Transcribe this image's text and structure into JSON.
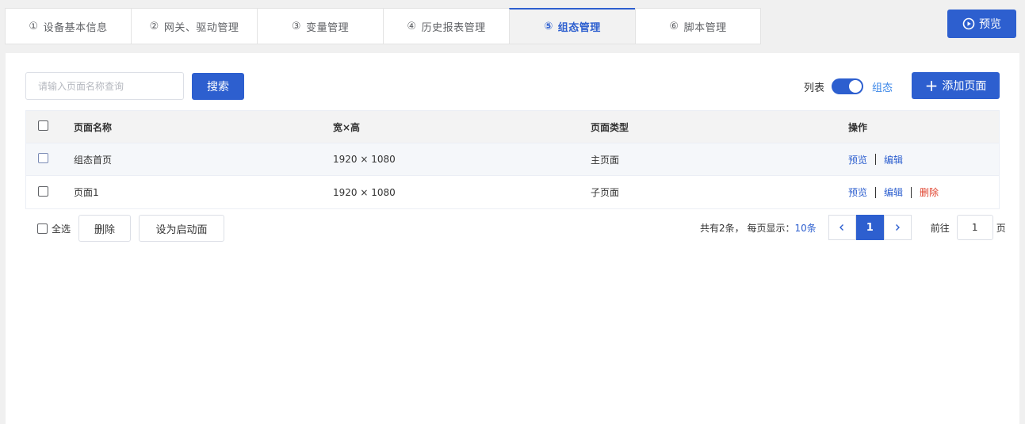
{
  "tabs": [
    {
      "num": "①",
      "label": "设备基本信息"
    },
    {
      "num": "②",
      "label": "网关、驱动管理"
    },
    {
      "num": "③",
      "label": "变量管理"
    },
    {
      "num": "④",
      "label": "历史报表管理"
    },
    {
      "num": "⑤",
      "label": "组态管理"
    },
    {
      "num": "⑥",
      "label": "脚本管理"
    }
  ],
  "active_tab": 4,
  "header": {
    "preview_label": "预览",
    "preview_icon": "play-circle-icon"
  },
  "toolbar": {
    "search_placeholder": "请输入页面名称查询",
    "search_value": "",
    "search_label": "搜索",
    "toggle_left_label": "列表",
    "toggle_right_label": "组态",
    "toggle_state": "组态",
    "add_label": "添加页面",
    "add_icon": "plus-icon"
  },
  "table": {
    "columns": [
      "页面名称",
      "宽×高",
      "页面类型",
      "操作"
    ],
    "rows": [
      {
        "name": "组态首页",
        "size": "1920 × 1080",
        "type": "主页面",
        "ops": [
          "预览",
          "编辑"
        ]
      },
      {
        "name": "页面1",
        "size": "1920 × 1080",
        "type": "子页面",
        "ops": [
          "预览",
          "编辑",
          "删除"
        ]
      }
    ]
  },
  "footer": {
    "select_all_label": "全选",
    "delete_label": "删除",
    "set_startup_label": "设为启动面"
  },
  "pagination": {
    "total_prefix": "共有2条，  每页显示：",
    "page_size": "10条",
    "current_page": "1",
    "goto_label": "前往",
    "goto_value": "1",
    "page_unit": "页"
  },
  "colors": {
    "accent": "#2d5fcf",
    "link": "#3a86e8",
    "danger": "#e0432e"
  }
}
